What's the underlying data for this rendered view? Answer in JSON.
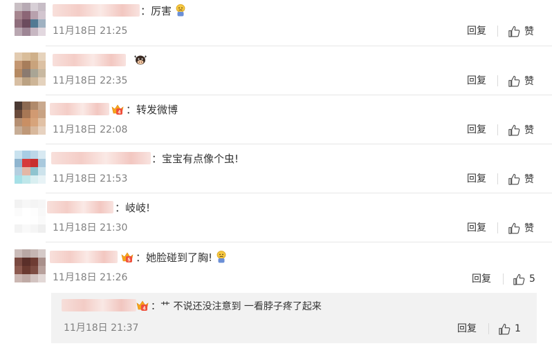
{
  "comments": [
    {
      "text": "：厉害",
      "time": "11月18日 21:25",
      "reply": "回复",
      "like": "赞"
    },
    {
      "text": "",
      "time": "11月18日 22:35",
      "reply": "回复",
      "like": "赞"
    },
    {
      "text": "：转发微博",
      "time": "11月18日 22:08",
      "reply": "回复",
      "like": "赞"
    },
    {
      "text": "：宝宝有点像个虫!",
      "time": "11月18日 21:53",
      "reply": "回复",
      "like": "赞"
    },
    {
      "text": "：岐岐!",
      "time": "11月18日 21:30",
      "reply": "回复",
      "like": "赞"
    },
    {
      "text": "：她脸碰到了胸!",
      "time": "11月18日 21:26",
      "reply": "回复",
      "like": "5"
    }
  ],
  "sub_reply": {
    "text": "：艹 不说还没注意到 一看脖子疼了起来",
    "time": "11月18日 21:37",
    "reply": "回复",
    "like": "1"
  },
  "icons": {
    "thumb": "thumbs-up-icon",
    "vip_badge": "vip-crown-badge-icon",
    "emoji_face": "sad-face-emoji-icon",
    "cow": "cow-emoji-icon"
  }
}
